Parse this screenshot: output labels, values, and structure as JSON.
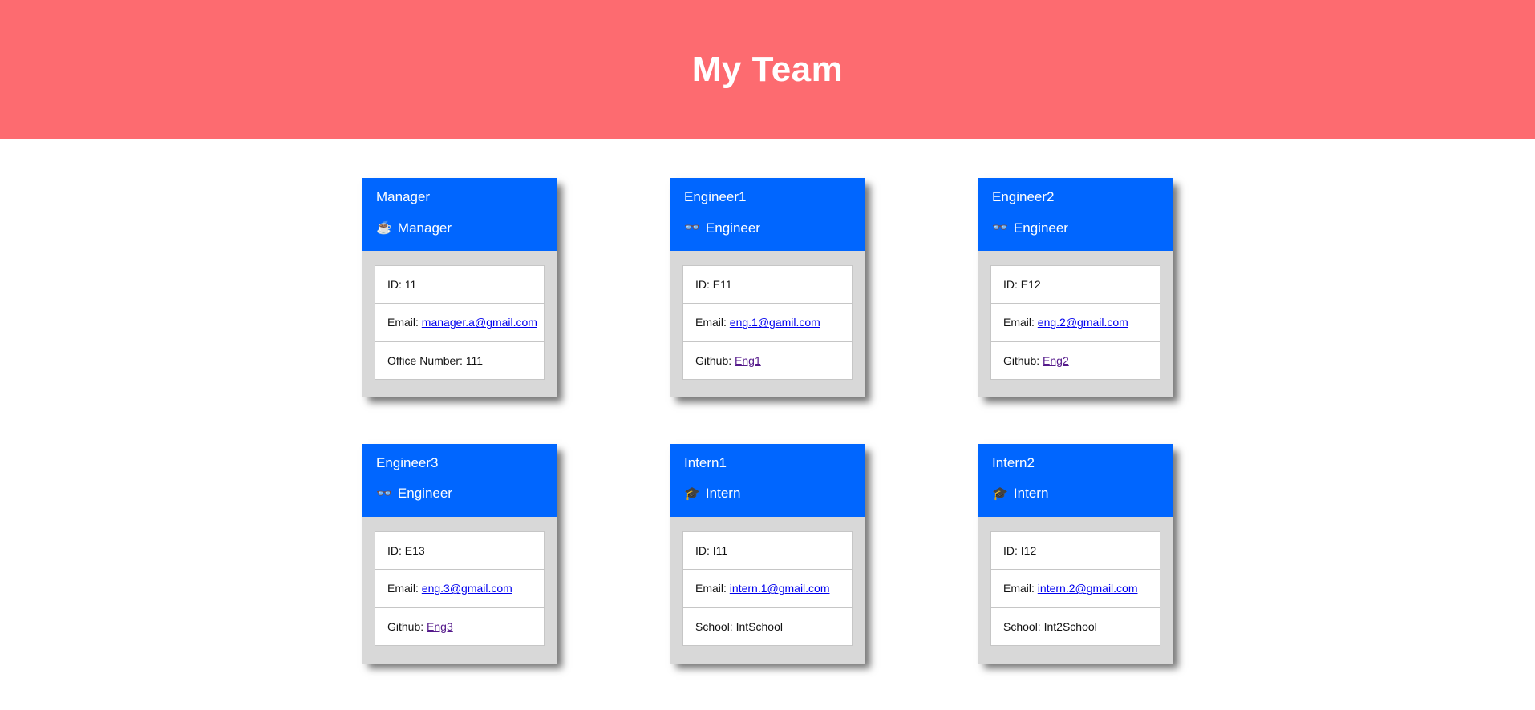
{
  "header": {
    "title": "My Team",
    "background_color": "#fd6b70",
    "text_color": "#ffffff"
  },
  "theme": {
    "card_header_color": "#0066ff",
    "card_body_color": "#d8d8d8",
    "link_color": "#0000ee",
    "visited_link_color": "#551a8b"
  },
  "cards": [
    {
      "name": "Manager",
      "role": "Manager",
      "icon": "coffee-cup-icon",
      "icon_glyph": "☕",
      "rows": [
        {
          "label": "ID:",
          "value": "11",
          "link": false
        },
        {
          "label": "Email:",
          "value": "manager.a@gmail.com",
          "link": true,
          "visited": false
        },
        {
          "label": "Office Number:",
          "value": "111",
          "link": false
        }
      ]
    },
    {
      "name": "Engineer1",
      "role": "Engineer",
      "icon": "glasses-icon",
      "icon_glyph": "👓",
      "rows": [
        {
          "label": "ID:",
          "value": "E11",
          "link": false
        },
        {
          "label": "Email:",
          "value": "eng.1@gamil.com",
          "link": true,
          "visited": false
        },
        {
          "label": "Github:",
          "value": "Eng1",
          "link": true,
          "visited": true
        }
      ]
    },
    {
      "name": "Engineer2",
      "role": "Engineer",
      "icon": "glasses-icon",
      "icon_glyph": "👓",
      "rows": [
        {
          "label": "ID:",
          "value": "E12",
          "link": false
        },
        {
          "label": "Email:",
          "value": "eng.2@gmail.com",
          "link": true,
          "visited": false
        },
        {
          "label": "Github:",
          "value": "Eng2",
          "link": true,
          "visited": true
        }
      ]
    },
    {
      "name": "Engineer3",
      "role": "Engineer",
      "icon": "glasses-icon",
      "icon_glyph": "👓",
      "rows": [
        {
          "label": "ID:",
          "value": "E13",
          "link": false
        },
        {
          "label": "Email:",
          "value": "eng.3@gmail.com",
          "link": true,
          "visited": false
        },
        {
          "label": "Github:",
          "value": "Eng3",
          "link": true,
          "visited": true
        }
      ]
    },
    {
      "name": "Intern1",
      "role": "Intern",
      "icon": "graduation-cap-icon",
      "icon_glyph": "🎓",
      "rows": [
        {
          "label": "ID:",
          "value": "I11",
          "link": false
        },
        {
          "label": "Email:",
          "value": "intern.1@gmail.com",
          "link": true,
          "visited": false
        },
        {
          "label": "School:",
          "value": "IntSchool",
          "link": false
        }
      ]
    },
    {
      "name": "Intern2",
      "role": "Intern",
      "icon": "graduation-cap-icon",
      "icon_glyph": "🎓",
      "rows": [
        {
          "label": "ID:",
          "value": "I12",
          "link": false
        },
        {
          "label": "Email:",
          "value": "intern.2@gmail.com",
          "link": true,
          "visited": false
        },
        {
          "label": "School:",
          "value": "Int2School",
          "link": false
        }
      ]
    }
  ]
}
